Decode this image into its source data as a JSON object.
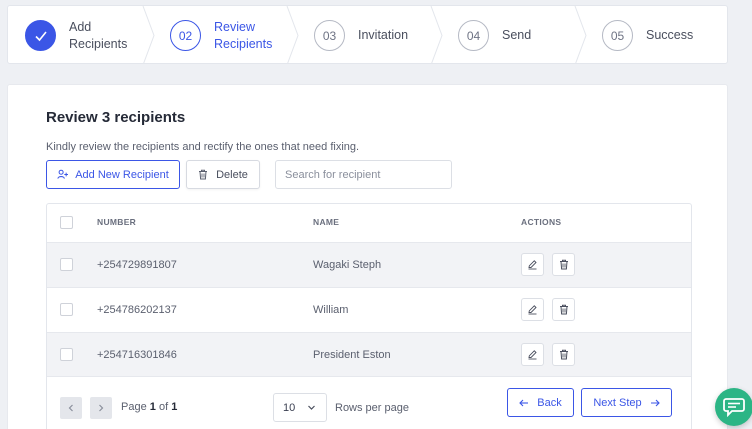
{
  "stepper": {
    "steps": [
      {
        "number": "",
        "label_line1": "Add",
        "label_line2": "Recipients",
        "state": "done"
      },
      {
        "number": "02",
        "label_line1": "Review",
        "label_line2": "Recipients",
        "state": "active"
      },
      {
        "number": "03",
        "label": "Invitation",
        "state": "pending"
      },
      {
        "number": "04",
        "label": "Send",
        "state": "pending"
      },
      {
        "number": "05",
        "label": "Success",
        "state": "pending"
      }
    ]
  },
  "review": {
    "title": "Review 3 recipients",
    "subtitle": "Kindly review the recipients and rectify the ones that need fixing.",
    "add_button": "Add New Recipient",
    "delete_button": "Delete",
    "search_placeholder": "Search for recipient"
  },
  "table": {
    "headers": {
      "number": "NUMBER",
      "name": "NAME",
      "actions": "ACTIONS"
    },
    "rows": [
      {
        "number": "+254729891807",
        "name": "Wagaki Steph"
      },
      {
        "number": "+254786202137",
        "name": "William"
      },
      {
        "number": "+254716301846",
        "name": "President Eston"
      }
    ]
  },
  "pagination": {
    "page_prefix": "Page",
    "current": "1",
    "of": "of",
    "total": "1",
    "per_page": "10",
    "rows_per_page_label": "Rows per page",
    "back_label": "Back",
    "next_label": "Next Step"
  },
  "colors": {
    "accent": "#3b56e6",
    "chat": "#2cb585"
  }
}
